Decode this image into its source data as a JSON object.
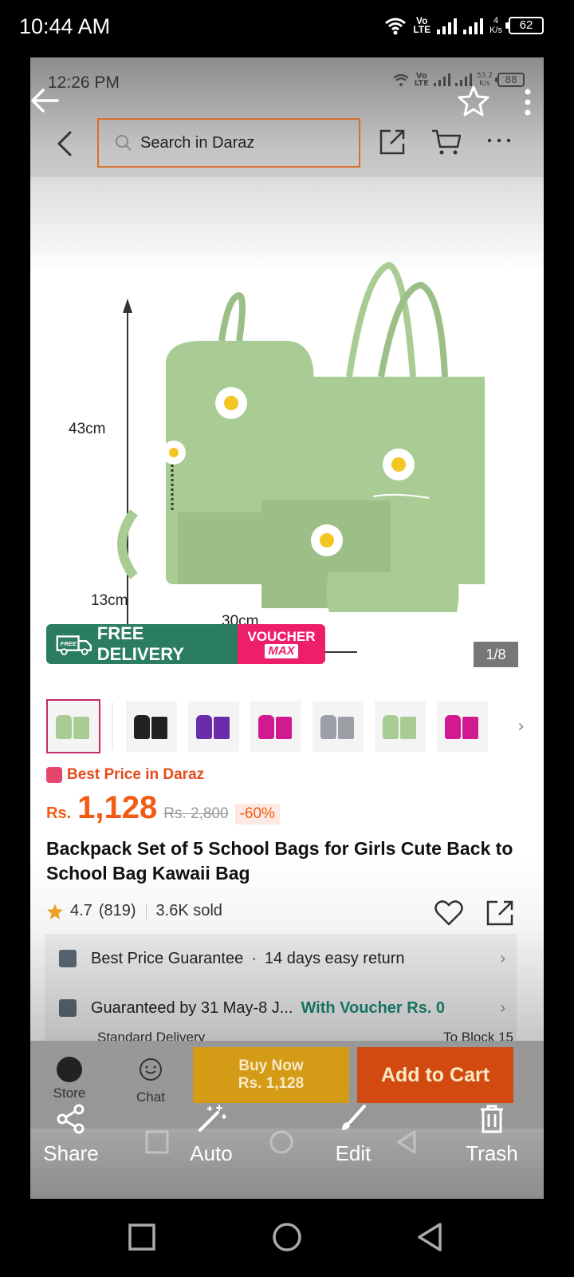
{
  "outer_status": {
    "time": "10:44 AM",
    "volte": "Vo\nLTE",
    "speed_value": "4",
    "speed_unit": "K/s",
    "battery": "62"
  },
  "inner_status": {
    "time": "12:26 PM",
    "volte": "Vo\nLTE",
    "speed_value": "53.2",
    "speed_unit": "K/s",
    "battery": "88"
  },
  "search": {
    "placeholder": "Search in Daraz"
  },
  "product_image": {
    "height_label": "43cm",
    "depth_label": "13cm",
    "width_label": "30cm",
    "counter": "1/8"
  },
  "delivery_badge": {
    "free_tag": "FREE",
    "label": "FREE DELIVERY",
    "voucher_line1": "VOUCHER",
    "voucher_line2": "MAX"
  },
  "thumbnails": [
    {
      "color": "#a9cc94"
    },
    {
      "color": "#222222"
    },
    {
      "color": "#6a2ca8"
    },
    {
      "color": "#d11a8f"
    },
    {
      "color": "#9aa0a6"
    },
    {
      "color": "#a9cc94"
    },
    {
      "color": "#d11a8f"
    }
  ],
  "price": {
    "best_price_label": "Best Price in Daraz",
    "currency": "Rs.",
    "current": "1,128",
    "original": "Rs. 2,800",
    "discount": "-60%"
  },
  "product": {
    "title": "Backpack Set of 5 School Bags for Girls Cute Back to School Bag Kawaii Bag",
    "rating": "4.7",
    "rating_count": "(819)",
    "sold": "3.6K sold"
  },
  "info": {
    "guarantee": "Best Price Guarantee",
    "return": "14 days easy return",
    "delivery": "Guaranteed by 31 May-8 J...",
    "voucher": "With Voucher Rs. 0",
    "delivery_type": "Standard Delivery",
    "to_block": "To Block 15"
  },
  "bottom_bar": {
    "store": "Store",
    "chat": "Chat",
    "buy_now_line1": "Buy Now",
    "buy_now_line2": "Rs. 1,128",
    "add_to_cart": "Add to Cart"
  },
  "actions": {
    "share": "Share",
    "auto": "Auto",
    "edit": "Edit",
    "trash": "Trash"
  },
  "colors": {
    "accent_orange": "#f35b15",
    "bag_green": "#a9cc94",
    "daraz_teal": "#2a7d5f",
    "voucher_pink": "#ee1f6a"
  }
}
